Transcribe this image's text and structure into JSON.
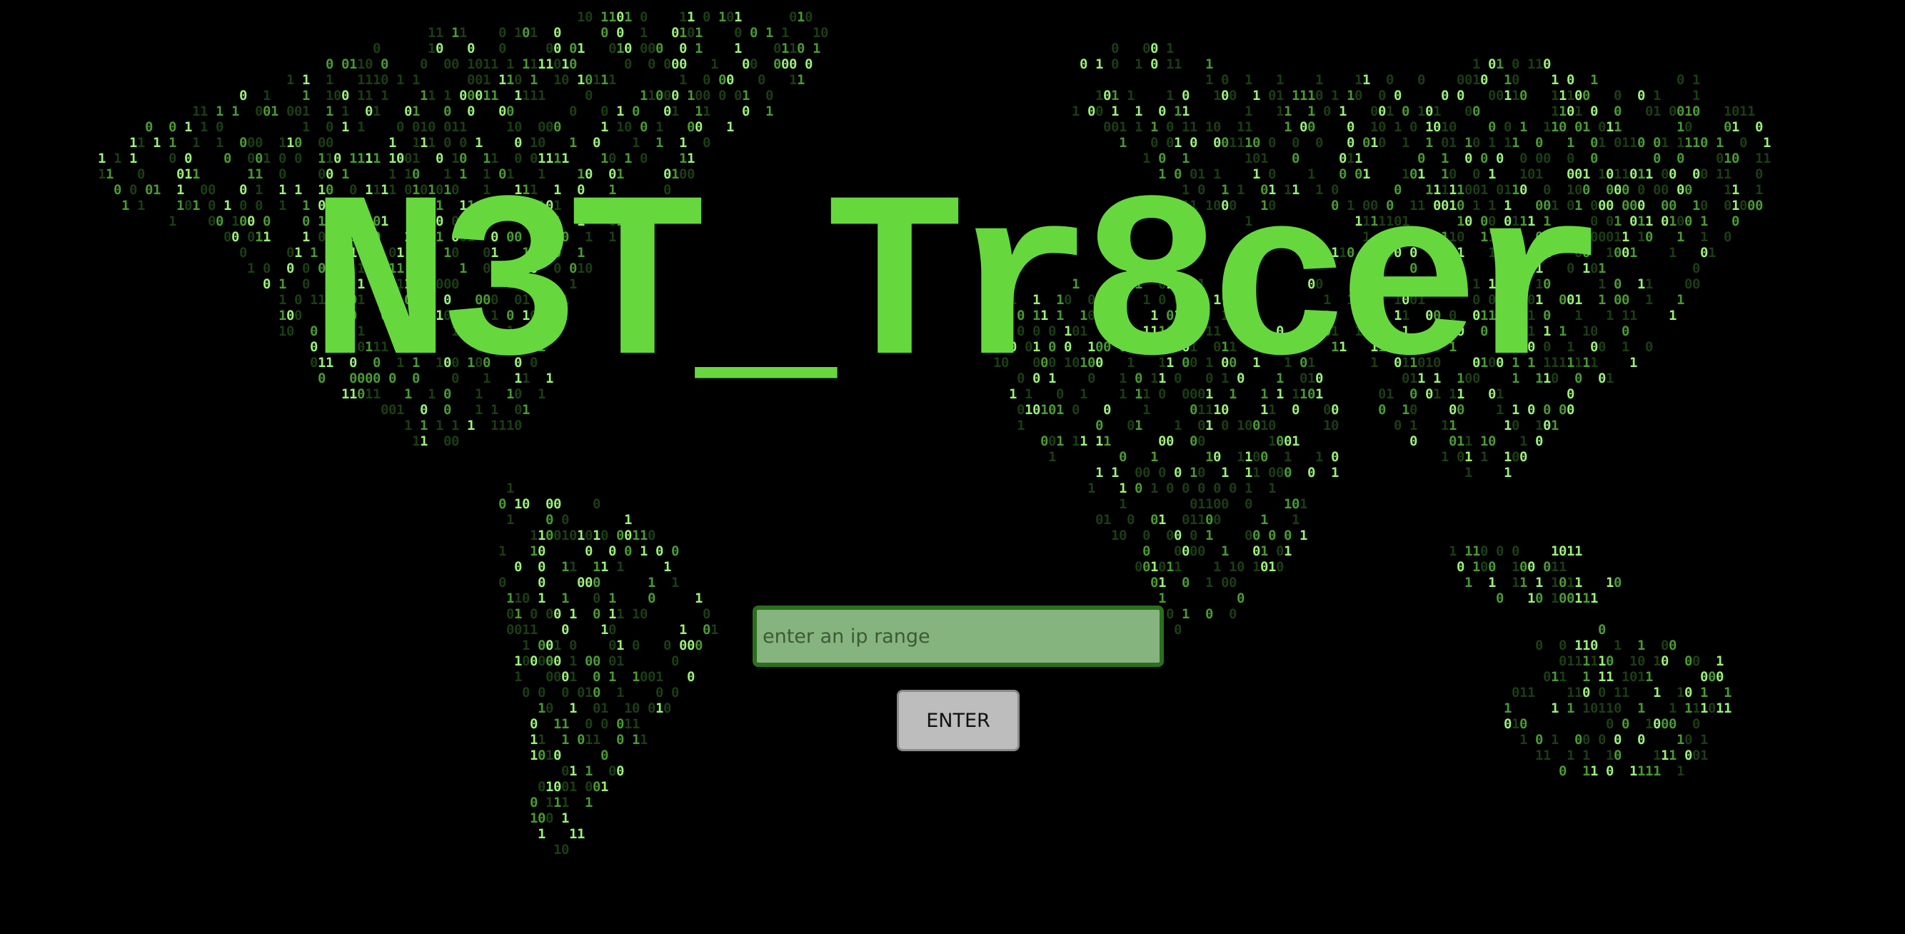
{
  "app": {
    "title": "N3T_Tr8cer"
  },
  "search": {
    "placeholder": "enter an ip range",
    "value": ""
  },
  "actions": {
    "enter_label": "ENTER"
  },
  "theme": {
    "background": "#000000",
    "accent_green": "#66d83e",
    "input_fill": "#86b47f",
    "input_border": "#2c6f1e",
    "button_fill": "#bdbdbd",
    "binary_bright": "#9cf07a",
    "binary_mid": "#4a9a33",
    "binary_dim": "#1c3d14"
  },
  "background_art": {
    "style": "binary-digit world map",
    "digits": [
      "0",
      "1"
    ]
  }
}
